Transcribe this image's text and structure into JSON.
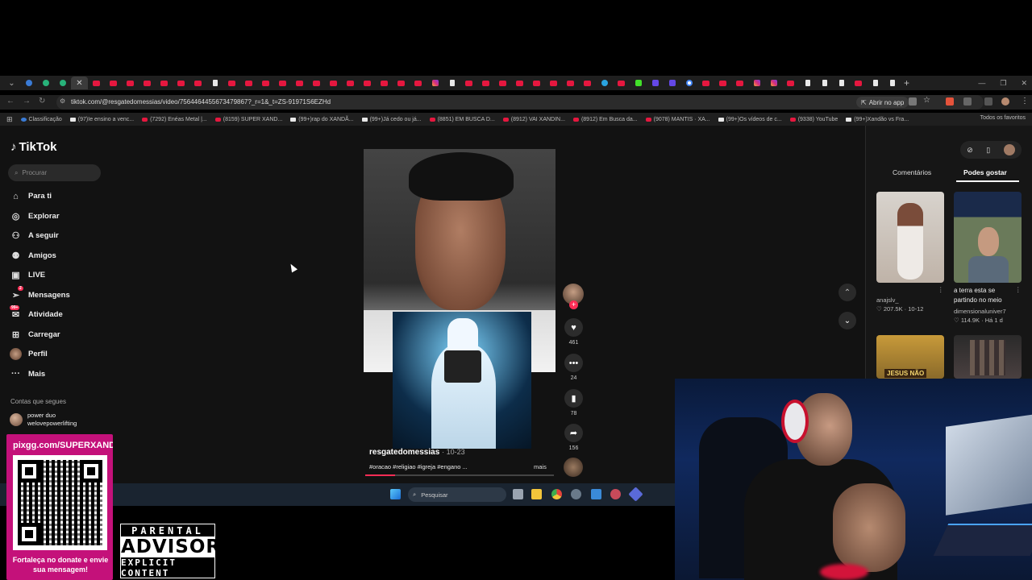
{
  "browser": {
    "url": "tiktok.com/@resgatedomessias/video/7564464455673479867?_r=1&_t=ZS-91971S6EZHd",
    "open_in_app": "Abrir no app",
    "bookmarks": [
      {
        "label": "Classificação",
        "kind": "bl"
      },
      {
        "label": "(97)Ie ensino a venc...",
        "kind": "tt"
      },
      {
        "label": "(7292) Enéas Metal |...",
        "kind": "yt"
      },
      {
        "label": "(8159) SUPER XAND...",
        "kind": "yt"
      },
      {
        "label": "(99+)rap do XANDÃ...",
        "kind": "tt"
      },
      {
        "label": "(99+)Já cedo ou já...",
        "kind": "tt"
      },
      {
        "label": "(8851) EM BUSCA D...",
        "kind": "yt"
      },
      {
        "label": "(8912) VAI XANDIN...",
        "kind": "yt"
      },
      {
        "label": "(8912) Em Busca da...",
        "kind": "yt"
      },
      {
        "label": "(9078) MANTIS · XA...",
        "kind": "yt"
      },
      {
        "label": "(99+)Os vídeos de c...",
        "kind": "tt"
      },
      {
        "label": "(9338) YouTube",
        "kind": "yt"
      },
      {
        "label": "(99+)Xandão vs Fra...",
        "kind": "tt"
      }
    ],
    "all_bookmarks": "Todos os favoritos"
  },
  "tiktok": {
    "logo": "TikTok",
    "search_placeholder": "Procurar",
    "nav": [
      {
        "label": "Para ti",
        "icon": "home-icon"
      },
      {
        "label": "Explorar",
        "icon": "compass-icon"
      },
      {
        "label": "A seguir",
        "icon": "following-icon"
      },
      {
        "label": "Amigos",
        "icon": "friends-icon"
      },
      {
        "label": "LIVE",
        "icon": "live-icon"
      },
      {
        "label": "Mensagens",
        "icon": "messages-icon",
        "badge": "2"
      },
      {
        "label": "Atividade",
        "icon": "activity-icon",
        "badge": "99+"
      },
      {
        "label": "Carregar",
        "icon": "upload-icon"
      },
      {
        "label": "Perfil",
        "icon": "profile-icon"
      },
      {
        "label": "Mais",
        "icon": "more-icon"
      }
    ],
    "following_title": "Contas que segues",
    "following": [
      {
        "name": "power duo",
        "handle": "welovepowerlifting"
      }
    ],
    "video": {
      "author": "resgatedomessias",
      "date": "10-23",
      "description": "#oracao #religiao #igreja #engano ...",
      "more": "mais",
      "likes": "461",
      "comments": "24",
      "saves": "78",
      "shares": "156",
      "progress": 0.16
    },
    "right_panel": {
      "tab_comments": "Comentários",
      "tab_you_may_like": "Podes gostar",
      "items": [
        {
          "title": "",
          "user": "anajslv_",
          "views": "207.5K",
          "date": "10-12"
        },
        {
          "title": "a terra esta se partindo no meio",
          "user": "dimensionaluniver7",
          "views": "114.9K",
          "date": "Há 1 d"
        },
        {
          "title": "JESUS NÃO",
          "user": "",
          "views": "",
          "date": ""
        }
      ]
    }
  },
  "taskbar": {
    "search_placeholder": "Pesquisar"
  },
  "overlay": {
    "qr_url": "pixgg.com/SUPERXANDAO",
    "qr_caption": "Fortaleça no donate e envie sua mensagem!",
    "parental_top": "PARENTAL",
    "parental_mid": "ADVISORY",
    "parental_bottom": "EXPLICIT CONTENT"
  }
}
